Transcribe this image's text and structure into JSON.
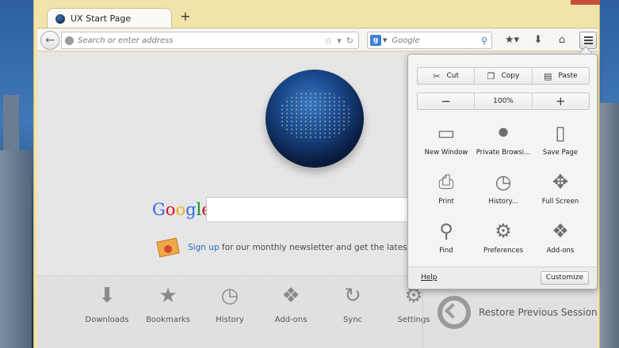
{
  "tab": {
    "title": "UX Start Page",
    "new_tab_symbol": "+"
  },
  "navbar": {
    "url_placeholder": "Search or enter address",
    "search_engine_letter": "g",
    "search_placeholder": "Google"
  },
  "content": {
    "google_logo": [
      "G",
      "o",
      "o",
      "g",
      "l",
      "e"
    ],
    "google_logo_colors": [
      "#3369e8",
      "#d50f25",
      "#eeb211",
      "#3369e8",
      "#009925",
      "#d50f25"
    ],
    "snippet_link": "Sign up",
    "snippet_text": " for our monthly newsletter and get the latest on your"
  },
  "launcher": {
    "items": [
      {
        "label": "Downloads",
        "icon": "download-icon"
      },
      {
        "label": "Bookmarks",
        "icon": "star-icon"
      },
      {
        "label": "History",
        "icon": "clock-icon"
      },
      {
        "label": "Add-ons",
        "icon": "puzzle-icon"
      },
      {
        "label": "Sync",
        "icon": "sync-icon"
      },
      {
        "label": "Settings",
        "icon": "gear-icon"
      }
    ],
    "restore_label": "Restore Previous Session"
  },
  "menu_panel": {
    "edit": {
      "cut": "Cut",
      "copy": "Copy",
      "paste": "Paste"
    },
    "zoom": {
      "minus": "−",
      "value": "100%",
      "plus": "+"
    },
    "items": [
      {
        "label": "New Window",
        "icon": "new-window-icon"
      },
      {
        "label": "Private Browsi...",
        "icon": "mask-icon"
      },
      {
        "label": "Save Page",
        "icon": "page-icon"
      },
      {
        "label": "Print",
        "icon": "printer-icon"
      },
      {
        "label": "History...",
        "icon": "clock-icon"
      },
      {
        "label": "Full Screen",
        "icon": "fullscreen-icon"
      },
      {
        "label": "Find",
        "icon": "magnifier-icon"
      },
      {
        "label": "Preferences",
        "icon": "gear-icon"
      },
      {
        "label": "Add-ons",
        "icon": "puzzle-icon"
      }
    ],
    "help": "Help",
    "customize": "Customize"
  }
}
